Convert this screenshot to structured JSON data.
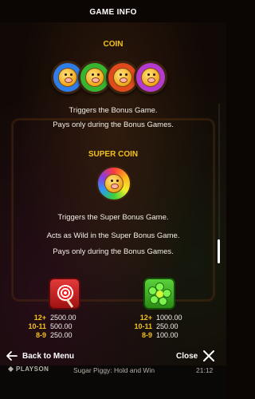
{
  "header": {
    "title": "GAME INFO"
  },
  "coin_section": {
    "title": "COIN",
    "coins": [
      {
        "color": "#2f7de8"
      },
      {
        "color": "#37b531"
      },
      {
        "color": "#e04a1c"
      },
      {
        "color": "#b53ad0"
      }
    ],
    "lines": [
      "Triggers the Bonus Game.",
      "Pays only during the Bonus Games."
    ]
  },
  "super_coin_section": {
    "title": "SUPER COIN",
    "lines": [
      "Triggers the Super Bonus Game.",
      "Acts as Wild in the Super Bonus Game.",
      "Pays only during the Bonus Games."
    ]
  },
  "paytables": {
    "lollipop": [
      {
        "count": "12+",
        "value": "2500.00"
      },
      {
        "count": "10-11",
        "value": "500.00"
      },
      {
        "count": "8-9",
        "value": "250.00"
      }
    ],
    "flower": [
      {
        "count": "12+",
        "value": "1000.00"
      },
      {
        "count": "10-11",
        "value": "250.00"
      },
      {
        "count": "8-9",
        "value": "100.00"
      }
    ]
  },
  "footer": {
    "back_label": "Back to Menu",
    "close_label": "Close"
  },
  "status_bar": {
    "brand": "PLAYSON",
    "game_name": "Sugar Piggy: Hold and Win",
    "time": "21:12"
  },
  "colors": {
    "accent_gold": "#f2c21b",
    "background": "#0b0604"
  }
}
